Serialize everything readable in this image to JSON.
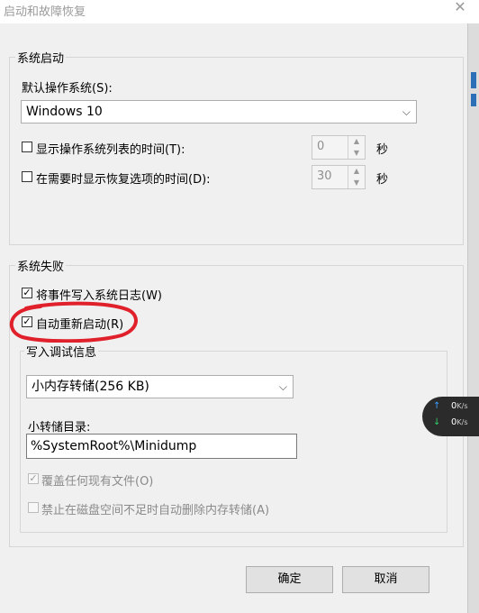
{
  "window": {
    "title": "启动和故障恢复",
    "close_glyph": "✕"
  },
  "system_startup": {
    "group_label": "系统启动",
    "default_os_label": "默认操作系统(S):",
    "default_os_value": "Windows 10",
    "show_os_list": {
      "label": "显示操作系统列表的时间(T):",
      "checked": false,
      "value": "0",
      "unit": "秒"
    },
    "show_recovery": {
      "label": "在需要时显示恢复选项的时间(D):",
      "checked": false,
      "value": "30",
      "unit": "秒"
    }
  },
  "system_failure": {
    "group_label": "系统失败",
    "write_event": {
      "label": "将事件写入系统日志(W)",
      "checked": true
    },
    "auto_restart": {
      "label": "自动重新启动(R)",
      "checked": true
    },
    "debug_info": {
      "group_label": "写入调试信息",
      "dump_type": "小内存转储(256 KB)",
      "dump_dir_label": "小转储目录:",
      "dump_dir_value": "%SystemRoot%\\Minidump",
      "overwrite": {
        "label": "覆盖任何现有文件(O)",
        "checked": true,
        "disabled": true
      },
      "disable_autodelete": {
        "label": "禁止在磁盘空间不足时自动删除内存转储(A)",
        "checked": false,
        "disabled": true
      }
    }
  },
  "buttons": {
    "ok": "确定",
    "cancel": "取消"
  },
  "check_glyph": "✓",
  "network_widget": {
    "up_arrow": "↑",
    "down_arrow": "↓",
    "upload_value": "0",
    "download_value": "0",
    "unit": "K/s",
    "up_color": "#3aa0ff",
    "down_color": "#33cc66"
  },
  "annotation_color": "#e0202a"
}
